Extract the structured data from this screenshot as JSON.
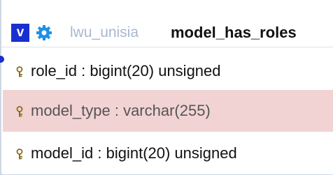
{
  "table": {
    "toggle_label": "v",
    "database": "lwu_unisia",
    "name": "model_has_roles"
  },
  "columns": [
    {
      "name": "role_id",
      "type": "bigint(20) unsigned",
      "highlighted": false
    },
    {
      "name": "model_type",
      "type": "varchar(255)",
      "highlighted": true
    },
    {
      "name": "model_id",
      "type": "bigint(20) unsigned",
      "highlighted": false
    }
  ],
  "column_texts": [
    "role_id : bigint(20) unsigned",
    "model_type : varchar(255)",
    "model_id : bigint(20) unsigned"
  ],
  "icons": {
    "options": "gear-icon",
    "primary_key": "key-icon"
  },
  "colors": {
    "toggle_bg": "#1a2fd0",
    "db_name": "#a8b8cf",
    "highlight_row": "#f2d3d3"
  }
}
